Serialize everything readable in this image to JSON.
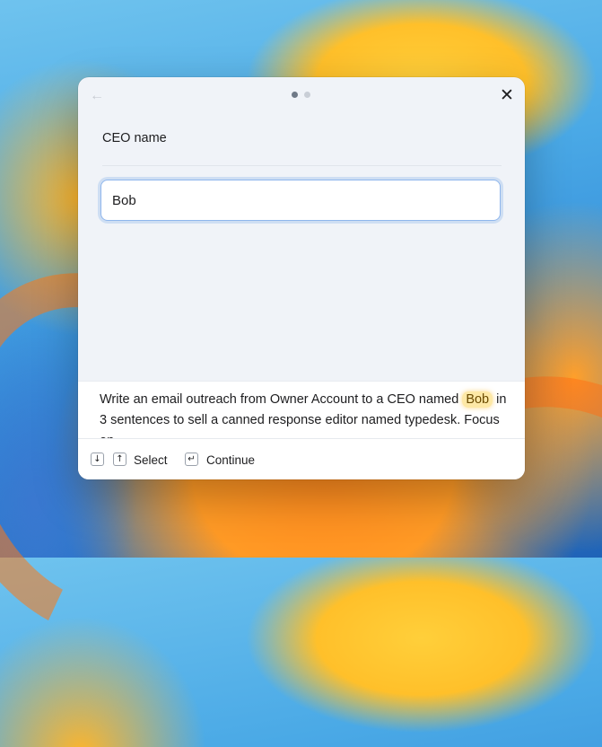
{
  "dialog": {
    "back_icon": "arrow-left-icon",
    "close_icon": "close-icon",
    "step_count": 2,
    "step_active": 1
  },
  "form": {
    "label": "CEO name",
    "value": "Bob"
  },
  "preview": {
    "before": "Write an email outreach from Owner Account to a CEO named ",
    "highlight": "Bob",
    "after": " in 3 sentences to sell a canned response editor named typedesk. Focus on ."
  },
  "footer": {
    "down_key": "↓",
    "up_key": "↑",
    "select_label": "Select",
    "enter_key": "↵",
    "continue_label": "Continue"
  },
  "colors": {
    "highlight_bg": "#fde8a6",
    "focus_ring": "#8fb6ec",
    "dot_active": "#6f7987",
    "dot_inactive": "#c9ced6"
  }
}
